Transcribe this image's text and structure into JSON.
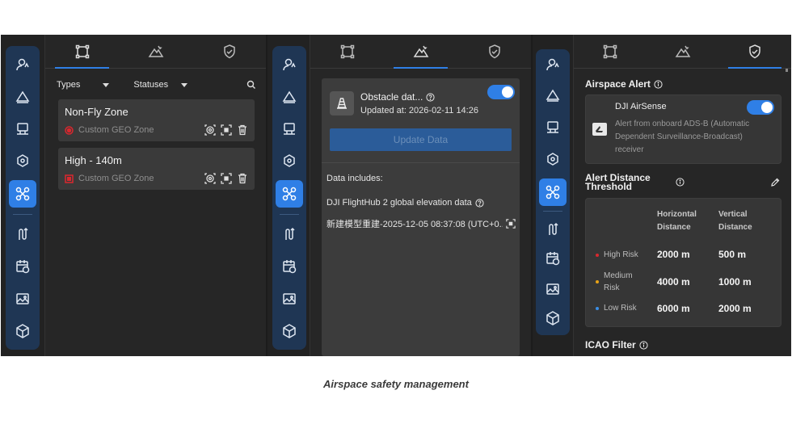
{
  "panel1": {
    "filters": {
      "types_label": "Types",
      "statuses_label": "Statuses"
    },
    "zones": [
      {
        "name": "Non-Fly Zone",
        "subtitle": "Custom GEO Zone",
        "color": "#d9272e",
        "shape": "circle"
      },
      {
        "name": "High - 140m",
        "subtitle": "Custom GEO Zone",
        "color": "#d9272e",
        "shape": "square"
      }
    ]
  },
  "panel2": {
    "obstacle_title": "Obstacle dat...",
    "updated_at": "Updated at: 2026-02-11 14:26",
    "update_button": "Update Data",
    "data_includes_label": "Data includes:",
    "data_source": "DJI FlightHub 2 global elevation data",
    "model_entry": "新建模型重建-2025-12-05 08:37:08 (UTC+0..."
  },
  "panel3": {
    "airspace_alert_title": "Airspace Alert",
    "airsense_title": "DJI AirSense",
    "airsense_desc": "Alert from onboard ADS-B (Automatic Dependent Surveillance-Broadcast) receiver",
    "threshold_title": "Alert Distance Threshold",
    "headers": {
      "horizontal": "Horizontal Distance",
      "vertical": "Vertical Distance"
    },
    "risks": [
      {
        "label": "High Risk",
        "color": "#d9272e",
        "horizontal": "2000 m",
        "vertical": "500 m"
      },
      {
        "label": "Medium Risk",
        "color": "#e8a317",
        "horizontal": "4000 m",
        "vertical": "1000 m"
      },
      {
        "label": "Low Risk",
        "color": "#3a8ee6",
        "horizontal": "6000 m",
        "vertical": "2000 m"
      }
    ],
    "icao_title": "ICAO Filter"
  },
  "caption": "Airspace safety management",
  "colors": {
    "accent": "#2f7fe6",
    "sidebar": "#1f3654",
    "panel_bg": "#262626",
    "card_bg": "#3a3a3a"
  }
}
